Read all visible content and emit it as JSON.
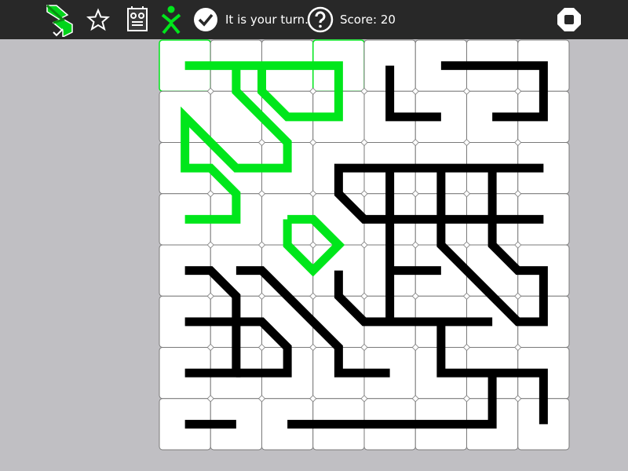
{
  "toolbar": {
    "activity_icon": "activity-icon",
    "star_icon": "star-icon",
    "robot_icon": "robot-icon",
    "player_icon": "player-icon",
    "confirm_icon": "check-icon",
    "turn_text": "It is your turn.",
    "help_icon": "help-icon",
    "score_text": "Score: 20",
    "stop_icon": "stop-icon"
  },
  "colors": {
    "toolbar_bg": "#282828",
    "background": "#c0bfc3",
    "tile_fill": "#ffffff",
    "tile_border": "#7a7a7a",
    "player_line": "#00e61b",
    "opponent_line": "#000000"
  },
  "board": {
    "rows": 8,
    "cols": 8,
    "highlighted_cells": [
      [
        0,
        0
      ],
      [
        3,
        0
      ]
    ],
    "green_paths": [
      [
        [
          0.5,
          0.5
        ],
        [
          3.5,
          0.5
        ],
        [
          3.5,
          1.5
        ],
        [
          2.5,
          1.5
        ],
        [
          2,
          1
        ],
        [
          2,
          0.5
        ]
      ],
      [
        [
          1.5,
          0.5
        ],
        [
          1.5,
          1
        ],
        [
          2.5,
          2
        ],
        [
          2.5,
          2.5
        ],
        [
          1.5,
          2.5
        ],
        [
          0.5,
          1.5
        ],
        [
          0.5,
          2.5
        ],
        [
          1,
          2.5
        ],
        [
          1.5,
          3
        ],
        [
          1.5,
          3.5
        ],
        [
          0.5,
          3.5
        ]
      ],
      [
        [
          2.5,
          3.5
        ],
        [
          3,
          3.5
        ],
        [
          3.5,
          4
        ],
        [
          3,
          4.5
        ],
        [
          2.5,
          4
        ],
        [
          2.5,
          3.5
        ]
      ]
    ],
    "black_paths": [
      [
        [
          4.5,
          0.5
        ],
        [
          4.5,
          1.5
        ],
        [
          5.5,
          1.5
        ]
      ],
      [
        [
          5.5,
          0.5
        ],
        [
          7.5,
          0.5
        ],
        [
          7.5,
          1.5
        ],
        [
          6.5,
          1.5
        ]
      ],
      [
        [
          7.5,
          2.5
        ],
        [
          3.5,
          2.5
        ],
        [
          3.5,
          3
        ],
        [
          4,
          3.5
        ],
        [
          7.5,
          3.5
        ]
      ],
      [
        [
          4.5,
          2.5
        ],
        [
          4.5,
          5.5
        ]
      ],
      [
        [
          5.5,
          2.5
        ],
        [
          5.5,
          4
        ],
        [
          7,
          5.5
        ],
        [
          7.5,
          5.5
        ],
        [
          7.5,
          4.5
        ],
        [
          7,
          4.5
        ],
        [
          6.5,
          4
        ],
        [
          6.5,
          2.5
        ]
      ],
      [
        [
          4.5,
          4.5
        ],
        [
          5.5,
          4.5
        ]
      ],
      [
        [
          3.5,
          4.5
        ],
        [
          3.5,
          5
        ],
        [
          4,
          5.5
        ],
        [
          6.5,
          5.5
        ]
      ],
      [
        [
          5.5,
          5.5
        ],
        [
          5.5,
          6.5
        ],
        [
          7.5,
          6.5
        ],
        [
          7.5,
          7.5
        ]
      ],
      [
        [
          6.5,
          6.5
        ],
        [
          6.5,
          7.5
        ],
        [
          2.5,
          7.5
        ]
      ],
      [
        [
          0.5,
          4.5
        ],
        [
          1,
          4.5
        ],
        [
          1.5,
          5
        ],
        [
          1.5,
          6.5
        ],
        [
          0.5,
          6.5
        ]
      ],
      [
        [
          0.5,
          5.5
        ],
        [
          2,
          5.5
        ],
        [
          2.5,
          6
        ],
        [
          2.5,
          6.5
        ],
        [
          1.5,
          6.5
        ]
      ],
      [
        [
          1.5,
          4.5
        ],
        [
          2,
          4.5
        ],
        [
          3.5,
          6
        ],
        [
          3.5,
          6.5
        ],
        [
          4.5,
          6.5
        ]
      ],
      [
        [
          0.5,
          7.5
        ],
        [
          1.5,
          7.5
        ]
      ]
    ]
  }
}
